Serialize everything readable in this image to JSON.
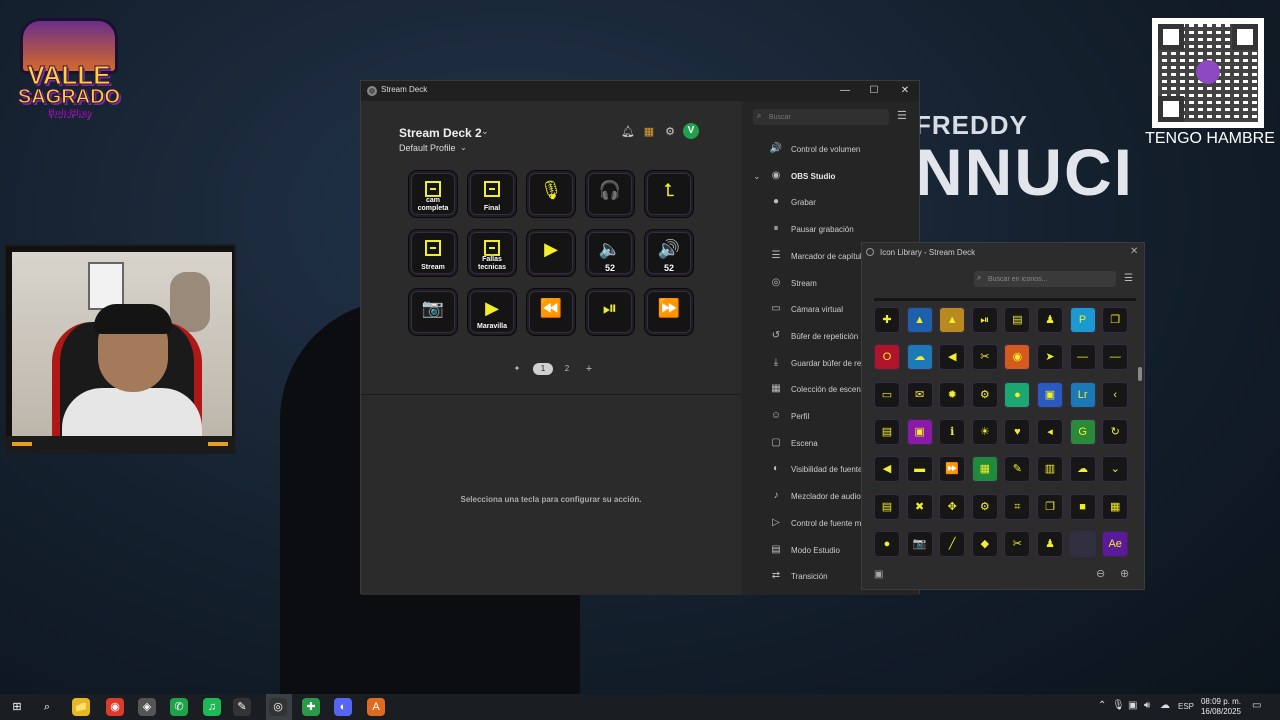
{
  "background": {
    "poster_small": "FREDDY",
    "poster_big": "NNUCI"
  },
  "logo": {
    "line1": "VALLE",
    "line2": "SAGRADO",
    "line3": "RolePlay"
  },
  "qr": {
    "label": "TENGO HAMBRE"
  },
  "stream_deck": {
    "window_title": "Stream Deck",
    "device_name": "Stream Deck 2",
    "profile_name": "Default Profile",
    "avatar_letter": "V",
    "keys": [
      {
        "icon": "film",
        "label": "cam completa"
      },
      {
        "icon": "film",
        "label": "Final"
      },
      {
        "icon": "🎙",
        "label": ""
      },
      {
        "icon": "🎧",
        "label": ""
      },
      {
        "icon": "⮤",
        "label": ""
      },
      {
        "icon": "film",
        "label": "Stream"
      },
      {
        "icon": "film",
        "label": "Fallas tecnicas"
      },
      {
        "icon": "▶",
        "label": ""
      },
      {
        "icon": "🔈",
        "label": "52"
      },
      {
        "icon": "🔊",
        "label": "52"
      },
      {
        "icon": "📷",
        "label": ""
      },
      {
        "icon": "▶",
        "label": "Maravilla"
      },
      {
        "icon": "⏪",
        "label": ""
      },
      {
        "icon": "⏯",
        "label": ""
      },
      {
        "icon": "⏩",
        "label": ""
      }
    ],
    "pages": [
      "1",
      "2"
    ],
    "empty_message": "Selecciona una tecla para configurar su acción.",
    "search_placeholder": "Buscar",
    "actions": [
      {
        "label": "Control de volumen",
        "icon": "🔊",
        "group": false
      },
      {
        "label": "OBS Studio",
        "icon": "◉",
        "group": true
      },
      {
        "label": "Grabar",
        "icon": "●",
        "group": false
      },
      {
        "label": "Pausar grabación",
        "icon": "⏸",
        "group": false
      },
      {
        "label": "Marcador de capítulo",
        "icon": "☰",
        "group": false
      },
      {
        "label": "Stream",
        "icon": "◎",
        "group": false
      },
      {
        "label": "Cámara virtual",
        "icon": "▭",
        "group": false
      },
      {
        "label": "Búfer de repetición",
        "icon": "↺",
        "group": false
      },
      {
        "label": "Guardar búfer de repetición",
        "icon": "⤓",
        "group": false
      },
      {
        "label": "Colección de escenas",
        "icon": "▦",
        "group": false
      },
      {
        "label": "Perfil",
        "icon": "☺",
        "group": false
      },
      {
        "label": "Escena",
        "icon": "▢",
        "group": false
      },
      {
        "label": "Visibilidad de fuente",
        "icon": "◐",
        "group": false
      },
      {
        "label": "Mezclador de audio",
        "icon": "♪",
        "group": false
      },
      {
        "label": "Control de fuente multimedia",
        "icon": "▷",
        "group": false
      },
      {
        "label": "Modo Estudio",
        "icon": "▤",
        "group": false
      },
      {
        "label": "Transición",
        "icon": "⇄",
        "group": false
      }
    ]
  },
  "icon_library": {
    "title": "Icon Library - Stream Deck",
    "search_placeholder": "Buscar en iconos...",
    "rows": [
      [
        {
          "g": "✚",
          "c": "#161616"
        },
        {
          "g": "▲",
          "c": "#1d5fa8"
        },
        {
          "g": "▲",
          "c": "#b88a20"
        },
        {
          "g": "⏯",
          "c": "#161616"
        },
        {
          "g": "▤",
          "c": "#161616"
        },
        {
          "g": "♟",
          "c": "#161616"
        },
        {
          "g": "P",
          "c": "#1a9ad0"
        },
        {
          "g": "❐",
          "c": "#161616"
        }
      ],
      [
        {
          "g": "O",
          "c": "#b0142a"
        },
        {
          "g": "☁",
          "c": "#1c7ab8"
        },
        {
          "g": "◀",
          "c": "#161616"
        },
        {
          "g": "✂",
          "c": "#161616"
        },
        {
          "g": "◉",
          "c": "#d65a1e"
        },
        {
          "g": "➤",
          "c": "#161616"
        },
        {
          "g": "—",
          "c": "#161616"
        },
        {
          "g": "—",
          "c": "#161616"
        }
      ],
      [
        {
          "g": "▭",
          "c": "#161616"
        },
        {
          "g": "✉",
          "c": "#161616"
        },
        {
          "g": "✹",
          "c": "#161616"
        },
        {
          "g": "⚙",
          "c": "#161616"
        },
        {
          "g": "●",
          "c": "#1aa870"
        },
        {
          "g": "▣",
          "c": "#2a5ac0"
        },
        {
          "g": "Lr",
          "c": "#1a7ab8"
        },
        {
          "g": "‹",
          "c": "#161616"
        }
      ],
      [
        {
          "g": "▤",
          "c": "#161616"
        },
        {
          "g": "▣",
          "c": "#8a1aa8"
        },
        {
          "g": "ℹ",
          "c": "#161616"
        },
        {
          "g": "☀",
          "c": "#161616"
        },
        {
          "g": "♥",
          "c": "#161616"
        },
        {
          "g": "◂",
          "c": "#161616"
        },
        {
          "g": "G",
          "c": "#2a8a3a"
        },
        {
          "g": "↻",
          "c": "#161616"
        }
      ],
      [
        {
          "g": "◀",
          "c": "#161616"
        },
        {
          "g": "▬",
          "c": "#161616"
        },
        {
          "g": "⏩",
          "c": "#161616"
        },
        {
          "g": "▦",
          "c": "#1f8a3a"
        },
        {
          "g": "✎",
          "c": "#161616"
        },
        {
          "g": "▥",
          "c": "#161616"
        },
        {
          "g": "☁",
          "c": "#161616"
        },
        {
          "g": "⌄",
          "c": "#161616"
        }
      ],
      [
        {
          "g": "▤",
          "c": "#161616"
        },
        {
          "g": "✖",
          "c": "#161616"
        },
        {
          "g": "✥",
          "c": "#161616"
        },
        {
          "g": "⚙",
          "c": "#161616"
        },
        {
          "g": "⌗",
          "c": "#161616"
        },
        {
          "g": "❐",
          "c": "#161616"
        },
        {
          "g": "■",
          "c": "#161616"
        },
        {
          "g": "▦",
          "c": "#161616"
        }
      ],
      [
        {
          "g": "●",
          "c": "#161616"
        },
        {
          "g": "📷",
          "c": "#161616"
        },
        {
          "g": "╱",
          "c": "#161616"
        },
        {
          "g": "◆",
          "c": "#161616"
        },
        {
          "g": "✂",
          "c": "#161616"
        },
        {
          "g": "♟",
          "c": "#161616"
        },
        {
          "g": "",
          "c": "#303040"
        },
        {
          "g": "Ae",
          "c": "#5a1a9a"
        }
      ]
    ]
  },
  "taskbar": {
    "icons": [
      "⊞",
      "⌕",
      "📁",
      "◉",
      "◈",
      "✆",
      "♫",
      "✎",
      "◎",
      "✚",
      "◐",
      "A"
    ],
    "lang": "ESP",
    "time": "08:09 p. m.",
    "date": "16/08/2025"
  }
}
